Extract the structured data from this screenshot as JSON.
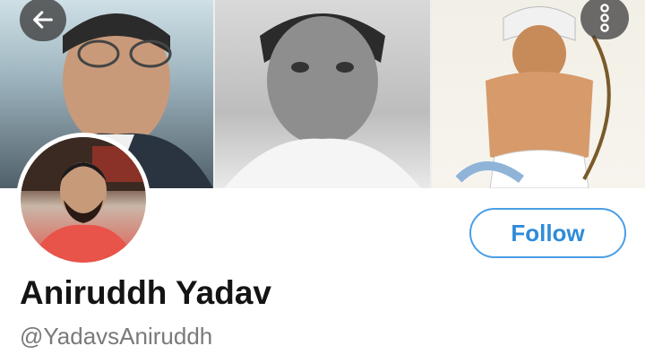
{
  "header": {
    "back_icon": "arrow-left-icon",
    "more_icon": "vertical-ellipsis-icon"
  },
  "profile": {
    "display_name": "Aniruddh Yadav",
    "handle": "@YadavsAniruddh",
    "follow_label": "Follow"
  },
  "colors": {
    "accent": "#2f8bd9",
    "follow_border": "#4a9ee6",
    "name_text": "#141414",
    "handle_text": "#7a7a7a"
  }
}
